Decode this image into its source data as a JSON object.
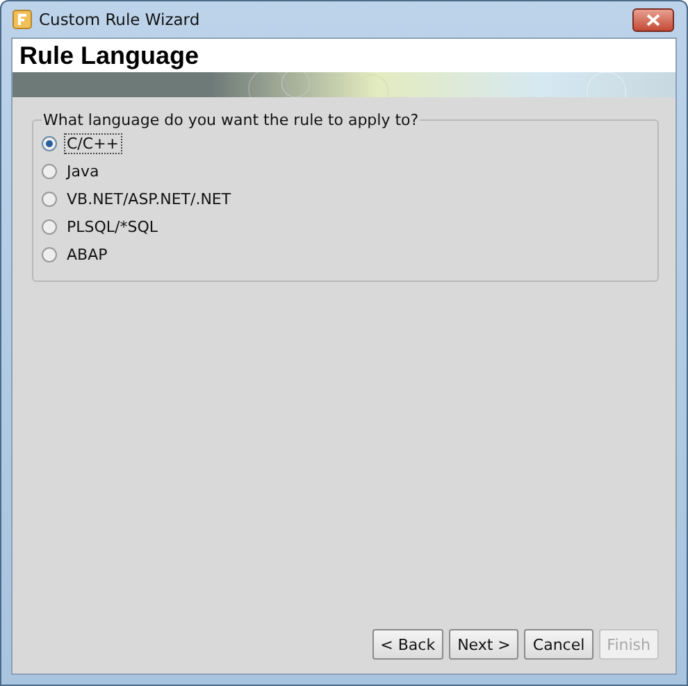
{
  "window": {
    "title": "Custom Rule Wizard"
  },
  "header": {
    "title": "Rule Language"
  },
  "group": {
    "legend": "What language do you want the rule to apply to?",
    "options": [
      {
        "label": "C/C++",
        "selected": true
      },
      {
        "label": "Java",
        "selected": false
      },
      {
        "label": "VB.NET/ASP.NET/.NET",
        "selected": false
      },
      {
        "label": "PLSQL/*SQL",
        "selected": false
      },
      {
        "label": "ABAP",
        "selected": false
      }
    ]
  },
  "buttons": [
    {
      "label": "< Back",
      "disabled": false
    },
    {
      "label": "Next >",
      "disabled": false
    },
    {
      "label": "Cancel",
      "disabled": false
    },
    {
      "label": "Finish",
      "disabled": true
    }
  ]
}
